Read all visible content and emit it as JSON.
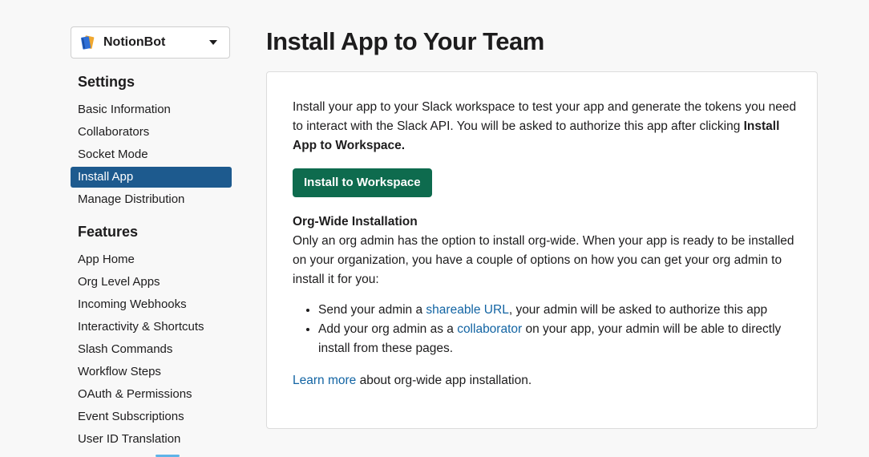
{
  "app_selector": {
    "name": "NotionBot",
    "icon": "notebook-icon",
    "caret": "caret-down-icon"
  },
  "sidebar": {
    "settings_title": "Settings",
    "settings_items": [
      {
        "label": "Basic Information"
      },
      {
        "label": "Collaborators"
      },
      {
        "label": "Socket Mode"
      },
      {
        "label": "Install App",
        "active": true
      },
      {
        "label": "Manage Distribution"
      }
    ],
    "features_title": "Features",
    "features_items": [
      {
        "label": "App Home"
      },
      {
        "label": "Org Level Apps"
      },
      {
        "label": "Incoming Webhooks"
      },
      {
        "label": "Interactivity & Shortcuts"
      },
      {
        "label": "Slash Commands"
      },
      {
        "label": "Workflow Steps"
      },
      {
        "label": "OAuth & Permissions"
      },
      {
        "label": "Event Subscriptions"
      },
      {
        "label": "User ID Translation"
      }
    ]
  },
  "main": {
    "title": "Install App to Your Team",
    "intro": "Install your app to your Slack workspace to test your app and generate the tokens you need to interact with the Slack API. You will be asked to authorize this app after clicking",
    "intro_bold": "Install App to Workspace.",
    "install_button": "Install to Workspace",
    "org_title": "Org-Wide Installation",
    "org_body": "Only an org admin has the option to install org-wide. When your app is ready to be installed on your organization, you have a couple of options on how you can get your org admin to install it for you:",
    "bullet1_pre": "Send your admin a ",
    "bullet1_link": "shareable URL",
    "bullet1_post": ", your admin will be asked to authorize this app",
    "bullet2_pre": "Add your org admin as a ",
    "bullet2_link": "collaborator",
    "bullet2_post": " on your app, your admin will be able to directly install from these pages.",
    "learn_link": "Learn more",
    "learn_post": " about org-wide app installation."
  },
  "colors": {
    "accent": "#1d5a8e",
    "button": "#0e6b4e",
    "link": "#1264a3"
  }
}
